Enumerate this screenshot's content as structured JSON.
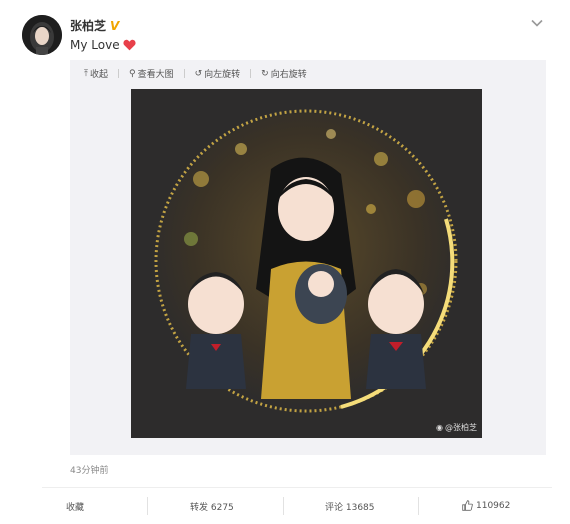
{
  "post": {
    "username": "张柏芝",
    "verified_badge": "V",
    "text": "My Love",
    "text_emoji": "heart-icon",
    "timestamp": "43分钟前"
  },
  "toolbar": {
    "collapse_label": "收起",
    "view_large_label": "查看大图",
    "rotate_left_label": "向左旋转",
    "rotate_right_label": "向右旋转"
  },
  "image": {
    "watermark_text": "@张柏芝"
  },
  "actions": {
    "favorite_label": "收藏",
    "repost_label": "转发 6275",
    "comment_label": "评论 13685",
    "like_count": "110962"
  },
  "colors": {
    "badge": "#f0a500",
    "heart": "#e8404a",
    "image_bg": "#2d2c2c",
    "gold": "#e8c24a"
  }
}
